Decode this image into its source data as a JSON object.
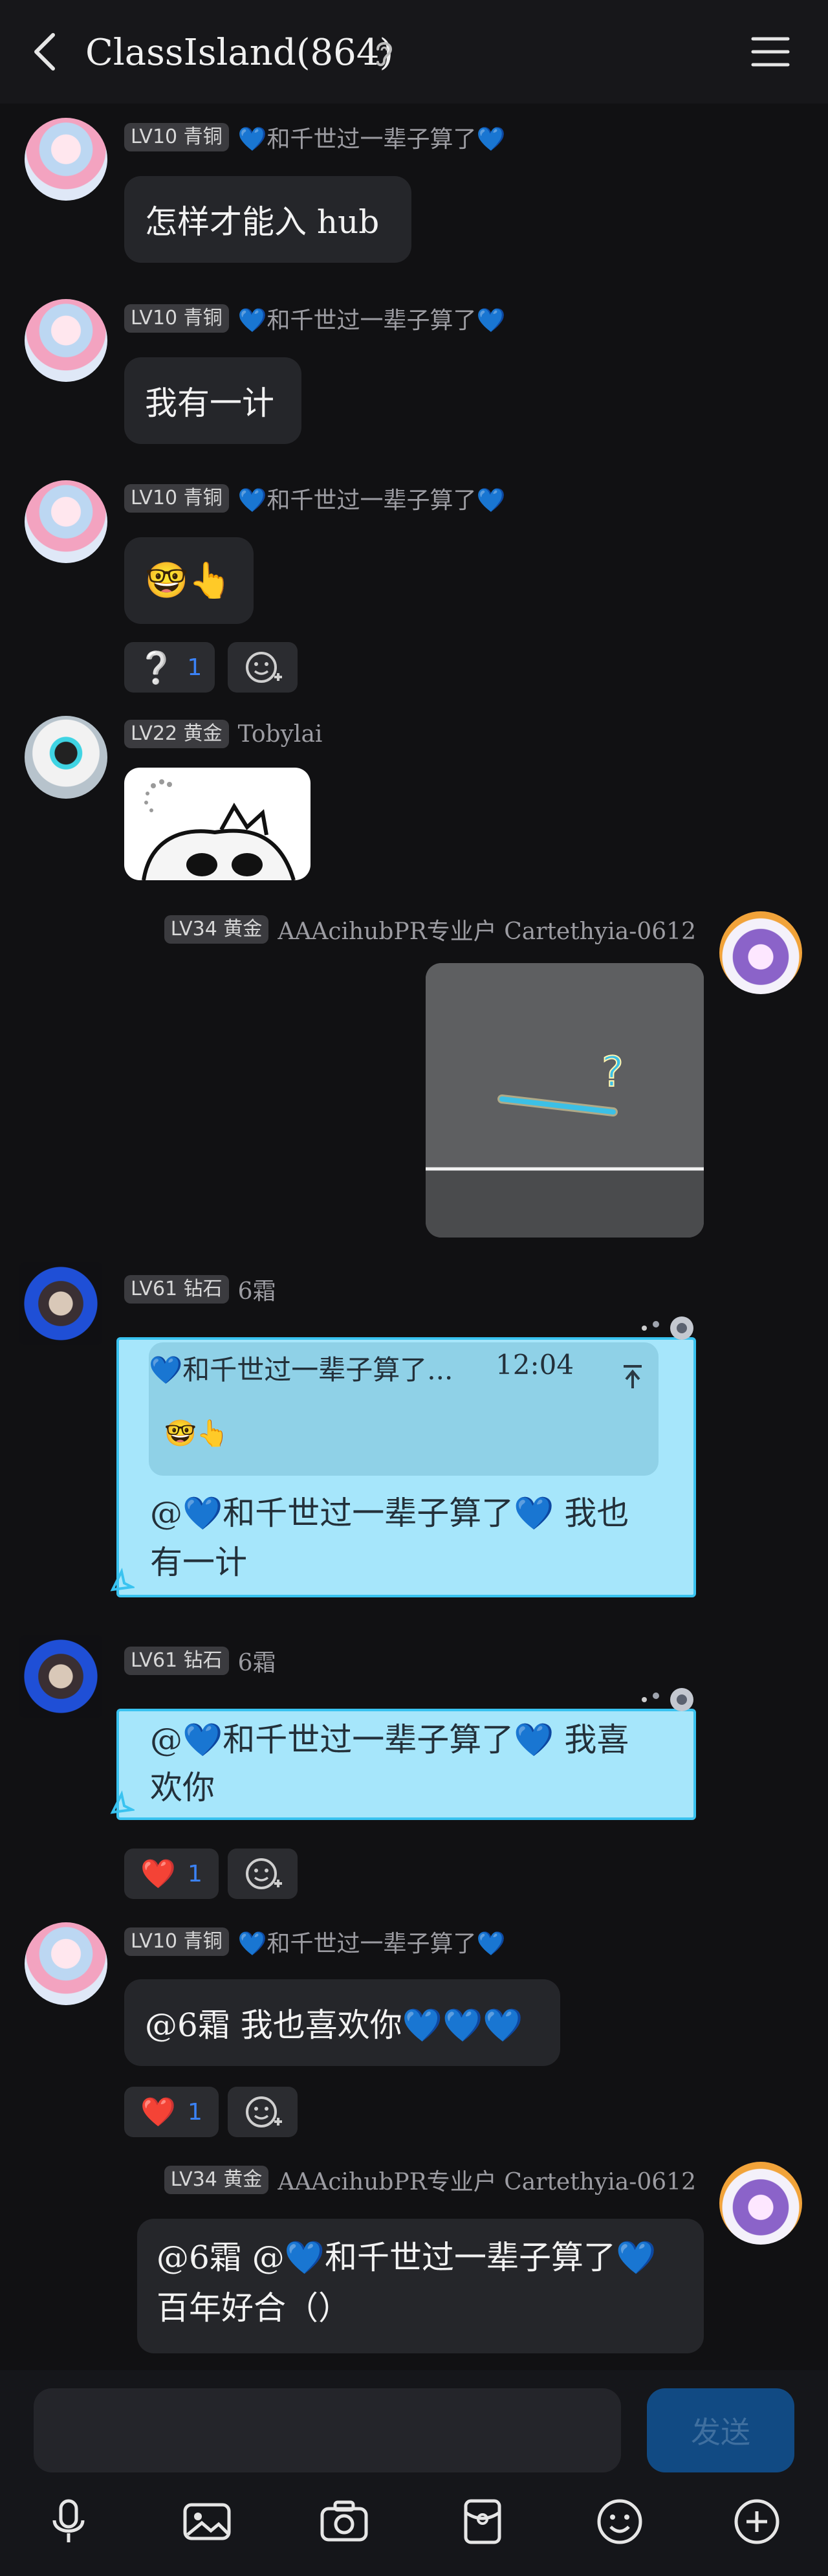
{
  "header": {
    "title": "ClassIsland(864)",
    "icons": [
      "back-arrow-icon",
      "ear-icon",
      "hamburger-menu-icon"
    ]
  },
  "messages": [
    {
      "level": "LV10 青铜",
      "nick": "💙和千世过一辈子算了💙",
      "text": "怎样才能入 hub"
    },
    {
      "level": "LV10 青铜",
      "nick": "💙和千世过一辈子算了💙",
      "text": "我有一计"
    },
    {
      "level": "LV10 青铜",
      "nick": "💙和千世过一辈子算了💙",
      "text": "🤓👆",
      "reaction": {
        "emoji": "❔",
        "count": "1"
      }
    },
    {
      "level": "LV22 黄金",
      "nick": "Tobylai"
    },
    {
      "level": "LV34 黄金",
      "nick": "AAAcihubPR专业户 Cartethyia-0612",
      "image_text": "?"
    },
    {
      "level": "LV61 钻石",
      "nick": "6霜",
      "quote": {
        "author": "💙和千世过一辈子算了...",
        "time": "12:04",
        "preview": "🤓👆"
      },
      "line1": "@💙和千世过一辈子算了💙 我也",
      "line2": "有一计"
    },
    {
      "level": "LV61 钻石",
      "nick": "6霜",
      "line1": "@💙和千世过一辈子算了💙 我喜",
      "line2": "欢你",
      "reaction": {
        "emoji": "❤️",
        "count": "1"
      }
    },
    {
      "level": "LV10 青铜",
      "nick": "💙和千世过一辈子算了💙",
      "text": "@6霜 我也喜欢你💙💙💙",
      "reaction": {
        "emoji": "❤️",
        "count": "1"
      }
    },
    {
      "level": "LV34 黄金",
      "nick": "AAAcihubPR专业户 Cartethyia-0612",
      "line1": "@6霜 @💙和千世过一辈子算了💙",
      "line2": "百年好合（）"
    }
  ],
  "composer": {
    "send_label": "发送",
    "tools": [
      "microphone-icon",
      "image-icon",
      "camera-icon",
      "red-packet-icon",
      "emoji-icon",
      "plus-icon"
    ]
  },
  "colors": {
    "background": "#111113",
    "bubble": "#25262a",
    "bubble_cyan": "#a6e6fb",
    "bubble_cyan_border": "#39c3f0",
    "send_button": "#114a83",
    "reaction_count": "#3b82f6"
  }
}
